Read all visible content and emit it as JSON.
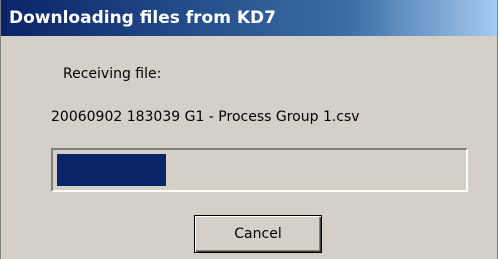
{
  "window": {
    "title": "Downloading files from KD7"
  },
  "content": {
    "status_label": "Receiving file:",
    "filename": "20060902 183039 G1 - Process Group 1.csv"
  },
  "progress": {
    "fraction": 0.27,
    "fill_color": "#0a246a"
  },
  "buttons": {
    "cancel_label": "Cancel"
  }
}
